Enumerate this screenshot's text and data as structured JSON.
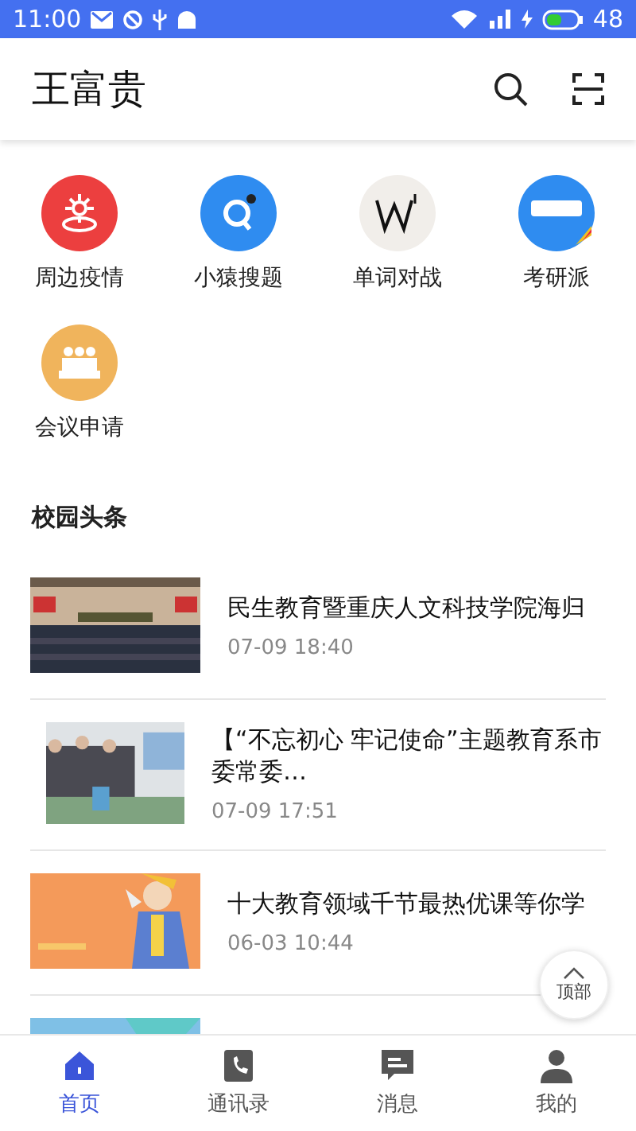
{
  "status_bar": {
    "time": "11:00",
    "battery": "48"
  },
  "header": {
    "title": "王富贵"
  },
  "apps": [
    {
      "label": "周边疫情",
      "color": "#ec3f3f"
    },
    {
      "label": "小猿搜题",
      "color": "#2f8cf0"
    },
    {
      "label": "单词对战",
      "color": "#f1eeea"
    },
    {
      "label": "考研派",
      "color": "#2f8cf0"
    },
    {
      "label": "会议申请",
      "color": "#f0b45c"
    }
  ],
  "section_title": "校园头条",
  "news": [
    {
      "kind": "article",
      "title": "民生教育暨重庆人文科技学院海归",
      "time": "07-09 18:40"
    },
    {
      "kind": "article",
      "title": "【“不忘初心 牢记使命”主题教育系市委常委…",
      "time": "07-09 17:51"
    },
    {
      "kind": "article",
      "title": "十大教育领域千节最热优课等你学",
      "time": "06-03 10:44"
    },
    {
      "kind": "picture"
    }
  ],
  "back_to_top": {
    "label": "顶部"
  },
  "tabs": [
    {
      "label": "首页",
      "selected": true
    },
    {
      "label": "通讯录",
      "selected": false
    },
    {
      "label": "消息",
      "selected": false
    },
    {
      "label": "我的",
      "selected": false
    }
  ]
}
